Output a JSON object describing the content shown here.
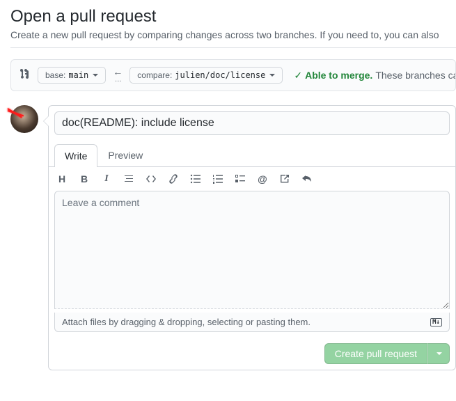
{
  "header": {
    "title": "Open a pull request",
    "subtitle": "Create a new pull request by comparing changes across two branches. If you need to, you can also"
  },
  "branches": {
    "base_label": "base:",
    "base_value": "main",
    "compare_label": "compare:",
    "compare_value": "julien/doc/license"
  },
  "merge": {
    "able": "Able to merge.",
    "rest": "These branches can be"
  },
  "form": {
    "title_value": "doc(README): include license",
    "tabs": {
      "write": "Write",
      "preview": "Preview"
    },
    "comment_placeholder": "Leave a comment",
    "attach_hint": "Attach files by dragging & dropping, selecting or pasting them.",
    "markdown_badge": "M↓",
    "submit_label": "Create pull request"
  },
  "toolbar": {
    "heading": "H",
    "bold": "B",
    "italic": "I",
    "at": "@"
  }
}
